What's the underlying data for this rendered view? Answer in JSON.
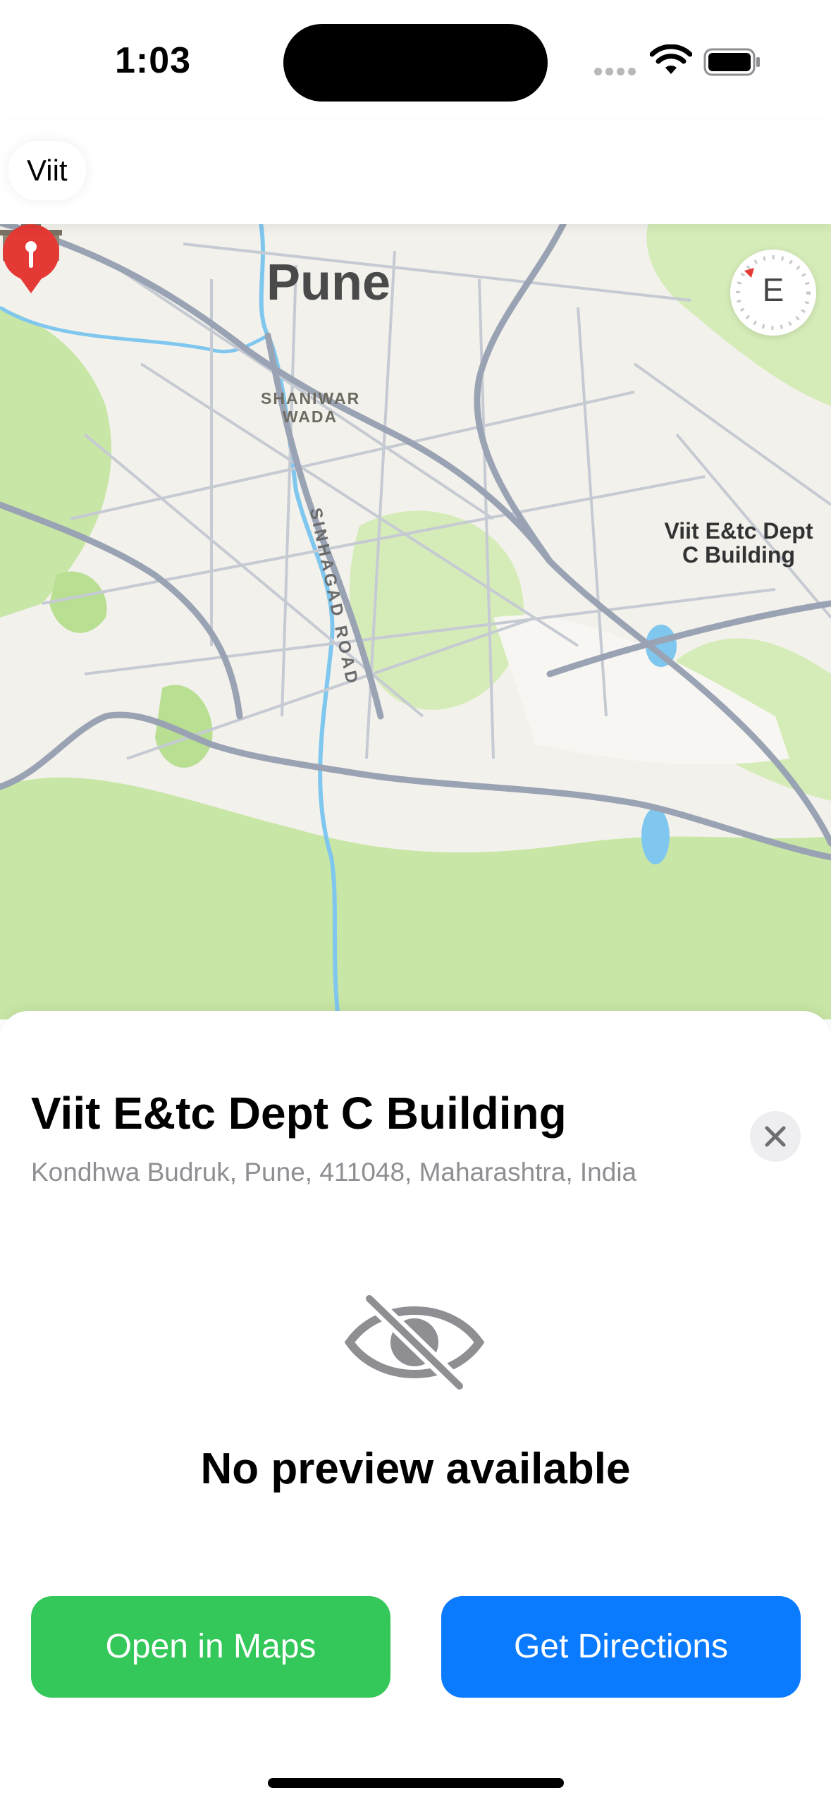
{
  "status_bar": {
    "time": "1:03",
    "icons": [
      "cellular-signal-icon",
      "wifi-icon",
      "battery-icon"
    ]
  },
  "nav": {
    "title": "Viit"
  },
  "map": {
    "city_label": "Pune",
    "landmark_label": "SHANIWAR WADA",
    "road_label": "SINHAGAD ROAD",
    "poi_label": "Viit E&tc Dept C Building",
    "compass_letter": "E",
    "colors": {
      "land": "#f3f1ec",
      "park": "#c8e6a5",
      "road": "#9aa3b3",
      "water": "#7fc7ef",
      "pin": "#e53935"
    }
  },
  "sheet": {
    "title": "Viit E&tc Dept C Building",
    "address": "Kondhwa Budruk, Pune, 411048, Maharashtra, India",
    "no_preview_text": "No preview available",
    "open_maps_label": "Open in Maps",
    "get_directions_label": "Get Directions",
    "colors": {
      "open_maps": "#34c759",
      "get_directions": "#0a7aff"
    }
  }
}
